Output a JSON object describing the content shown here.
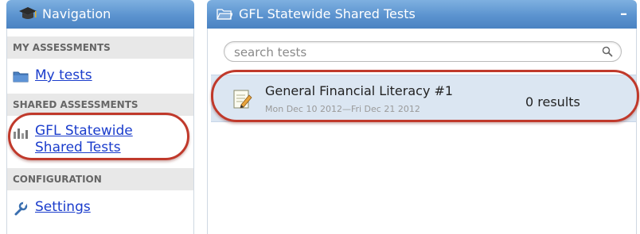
{
  "nav": {
    "title": "Navigation",
    "sections": [
      {
        "header": "MY ASSESSMENTS",
        "item": "My tests"
      },
      {
        "header": "SHARED ASSESSMENTS",
        "item_line1": "GFL Statewide",
        "item_line2": "Shared Tests"
      },
      {
        "header": "CONFIGURATION",
        "item": "Settings"
      }
    ]
  },
  "main": {
    "title": "GFL Statewide Shared Tests",
    "collapse_symbol": "–",
    "search_placeholder": "search tests",
    "tests": [
      {
        "name": "General Financial Literacy #1",
        "dates": "Mon Dec 10 2012—Fri Dec 21 2012",
        "results": "0 results"
      }
    ]
  },
  "colors": {
    "header_blue": "#5b93cf",
    "link_blue": "#1a3ccc",
    "highlight_red": "#c0392b",
    "row_bg": "#dbe6f2"
  }
}
